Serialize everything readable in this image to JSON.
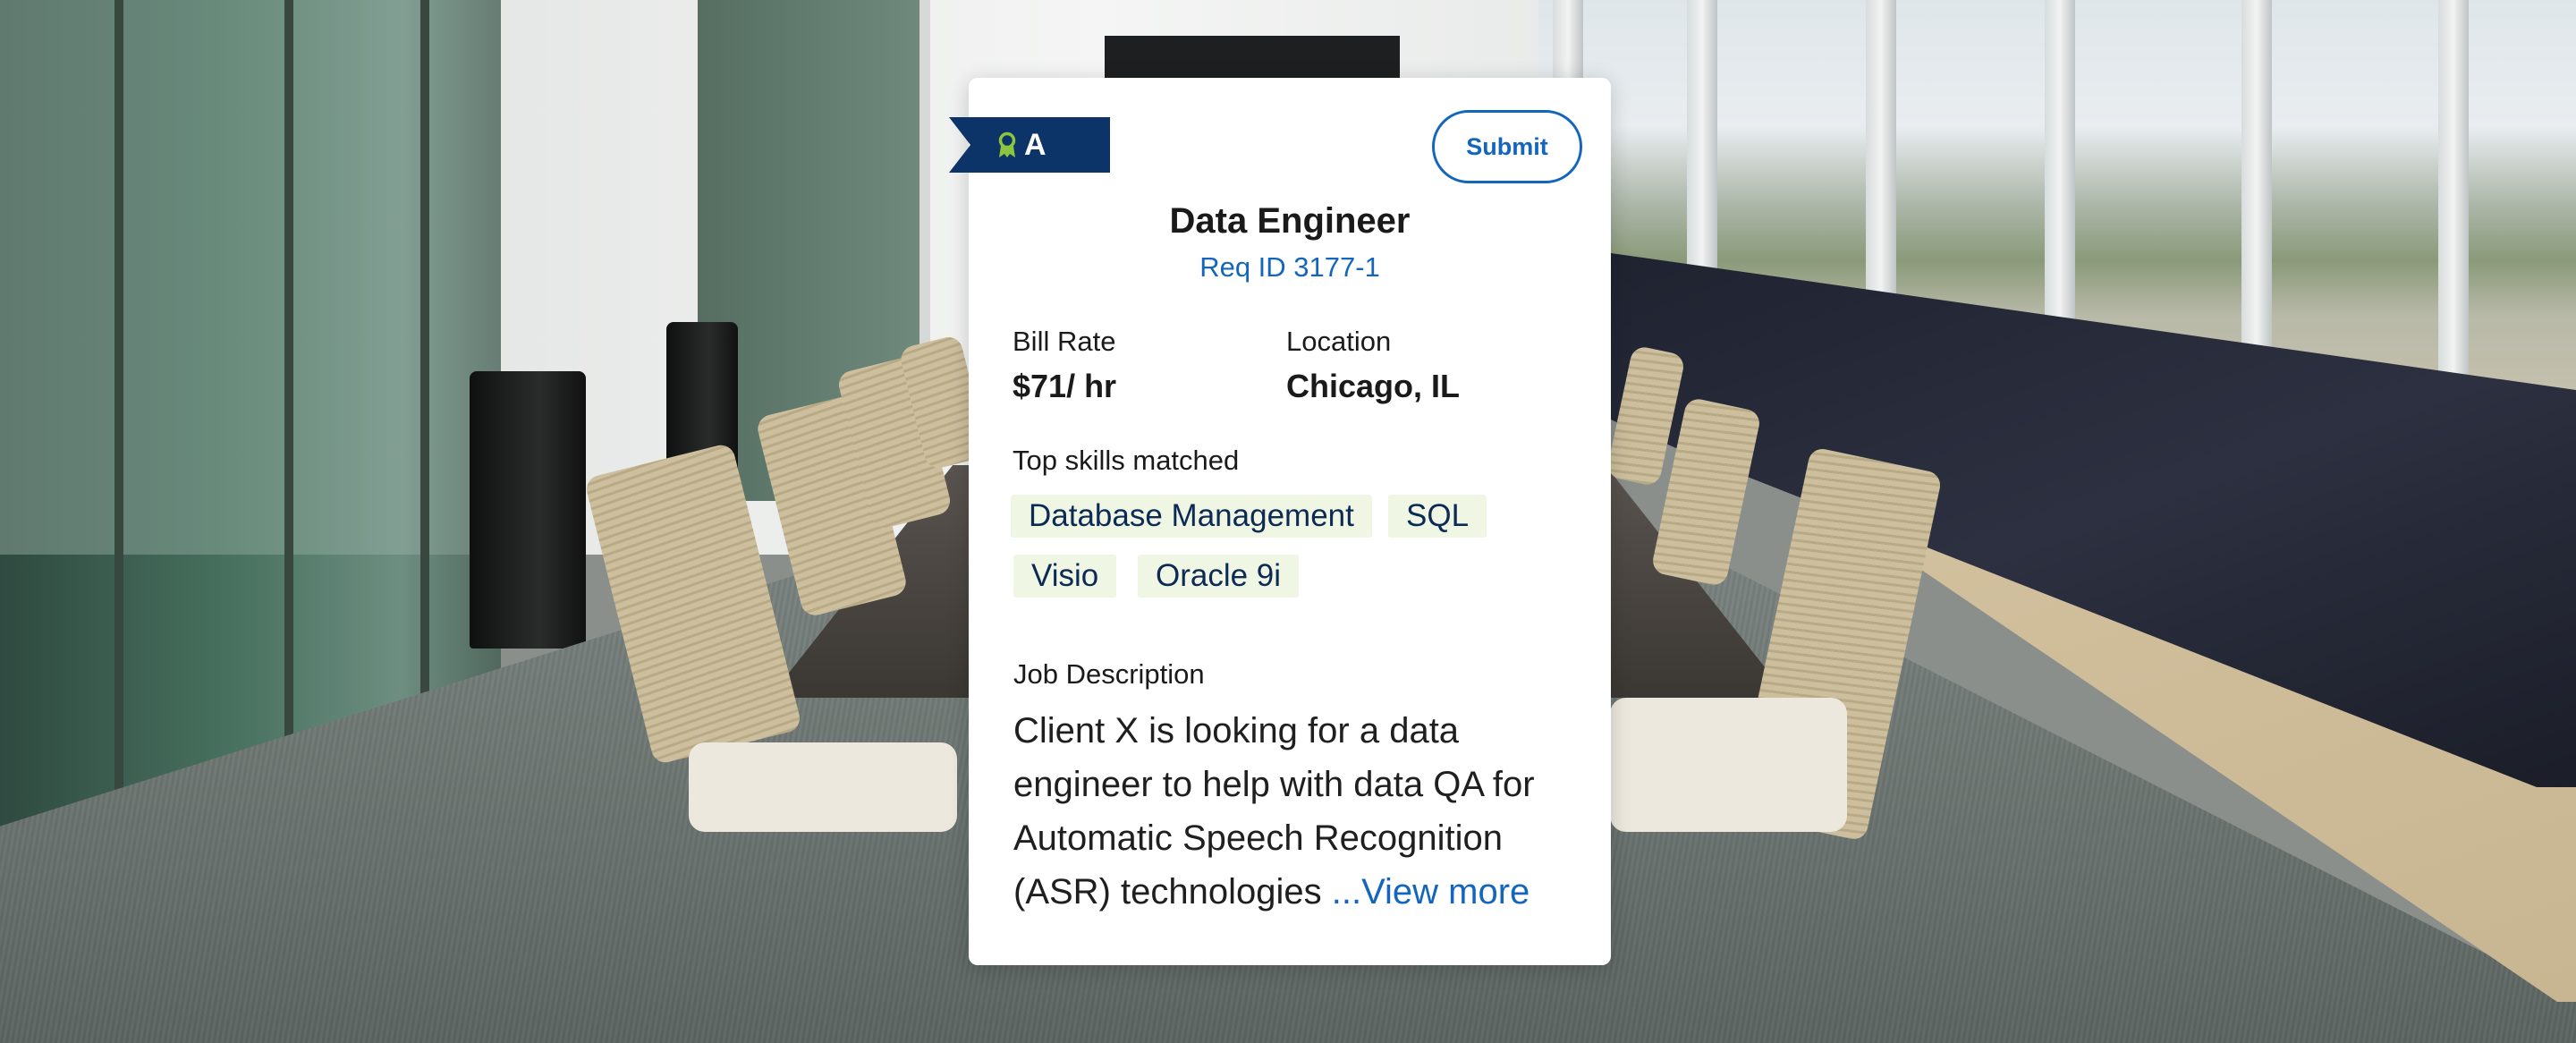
{
  "card": {
    "grade": "A",
    "submit_label": "Submit",
    "title": "Data Engineer",
    "req_id": "Req ID 3177-1",
    "bill_rate_label": "Bill Rate",
    "bill_rate_value": "$71/ hr",
    "location_label": "Location",
    "location_value": "Chicago, IL",
    "skills_label": "Top skills matched",
    "skills": [
      "Database Management",
      "SQL",
      "Visio",
      "Oracle 9i"
    ],
    "description_label": "Job Description",
    "description_text": "Client X is looking for a data engineer to help with data QA for Automatic Speech Recognition (ASR) technologies ",
    "view_more_label": "...View more"
  },
  "colors": {
    "ribbon": "#0d3468",
    "accent": "#1466bd",
    "chip_bg": "#eff6e4",
    "chip_text": "#0d2a55",
    "medal": "#8cc63f"
  },
  "icons": {
    "ribbon_badge": "award-medal-icon"
  }
}
